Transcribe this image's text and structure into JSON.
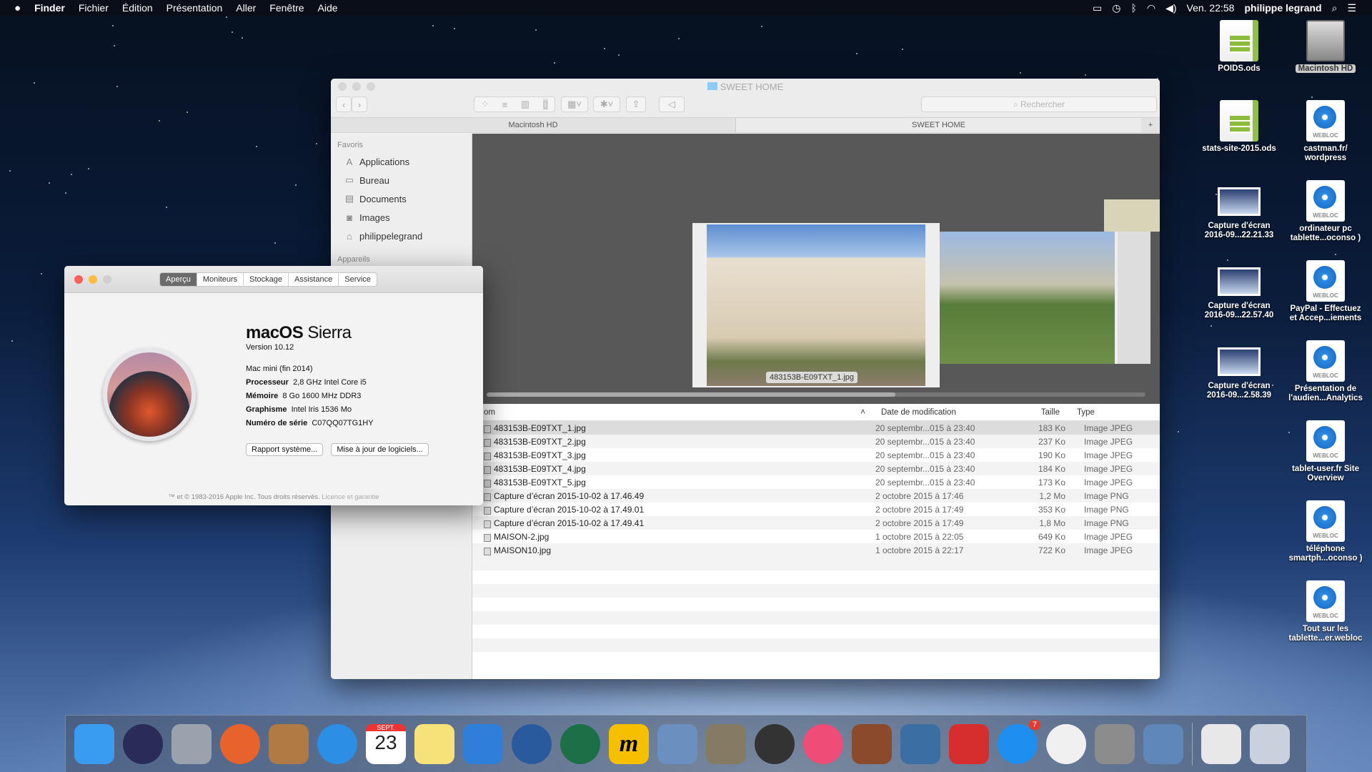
{
  "menubar": {
    "apple": "",
    "app": "Finder",
    "items": [
      "Fichier",
      "Édition",
      "Présentation",
      "Aller",
      "Fenêtre",
      "Aide"
    ],
    "clock": "Ven. 22:58",
    "user": "philippe legrand"
  },
  "finder": {
    "title": "SWEET HOME",
    "search_placeholder": "Rechercher",
    "tabs": [
      "Macintosh HD",
      "SWEET HOME"
    ],
    "sidebar": {
      "favorites_header": "Favoris",
      "favorites": [
        "Applications",
        "Bureau",
        "Documents",
        "Images",
        "philippelegrand"
      ],
      "devices_header": "Appareils"
    },
    "coverflow_caption": "483153B-E09TXT_1.jpg",
    "columns": {
      "name": "om",
      "date": "Date de modification",
      "size": "Taille",
      "type": "Type"
    },
    "files": [
      {
        "name": "483153B-E09TXT_1.jpg",
        "date": "20 septembr...015 à 23:40",
        "size": "183 Ko",
        "type": "Image JPEG"
      },
      {
        "name": "483153B-E09TXT_2.jpg",
        "date": "20 septembr...015 à 23:40",
        "size": "237 Ko",
        "type": "Image JPEG"
      },
      {
        "name": "483153B-E09TXT_3.jpg",
        "date": "20 septembr...015 à 23:40",
        "size": "190 Ko",
        "type": "Image JPEG"
      },
      {
        "name": "483153B-E09TXT_4.jpg",
        "date": "20 septembr...015 à 23:40",
        "size": "184 Ko",
        "type": "Image JPEG"
      },
      {
        "name": "483153B-E09TXT_5.jpg",
        "date": "20 septembr...015 à 23:40",
        "size": "173 Ko",
        "type": "Image JPEG"
      },
      {
        "name": "Capture d’écran 2015-10-02 à 17.46.49",
        "date": "2 octobre 2015 à 17:46",
        "size": "1,2 Mo",
        "type": "Image PNG"
      },
      {
        "name": "Capture d’écran 2015-10-02 à 17.49.01",
        "date": "2 octobre 2015 à 17:49",
        "size": "353 Ko",
        "type": "Image PNG"
      },
      {
        "name": "Capture d’écran 2015-10-02 à 17.49.41",
        "date": "2 octobre 2015 à 17:49",
        "size": "1,8 Mo",
        "type": "Image PNG"
      },
      {
        "name": "MAISON-2.jpg",
        "date": "1 octobre 2015 à 22:05",
        "size": "649 Ko",
        "type": "Image JPEG"
      },
      {
        "name": "MAISON10.jpg",
        "date": "1 octobre 2015 à 22:17",
        "size": "722 Ko",
        "type": "Image JPEG"
      }
    ]
  },
  "about": {
    "tabs": [
      "Aperçu",
      "Moniteurs",
      "Stockage",
      "Assistance",
      "Service"
    ],
    "os_name_bold": "macOS",
    "os_name": "Sierra",
    "version": "Version 10.12",
    "model": "Mac mini (fin 2014)",
    "specs": [
      {
        "label": "Processeur",
        "value": "2,8 GHz Intel Core i5"
      },
      {
        "label": "Mémoire",
        "value": "8 Go 1600 MHz DDR3"
      },
      {
        "label": "Graphisme",
        "value": "Intel Iris 1536 Mo"
      },
      {
        "label": "Numéro de série",
        "value": "C07QQ07TG1HY"
      }
    ],
    "buttons": [
      "Rapport système...",
      "Mise à jour de logiciels..."
    ],
    "copyright": "™ et © 1983-2016 Apple Inc. Tous droits réservés.",
    "license_link": "Licence et garantie"
  },
  "desktop": {
    "left": [
      {
        "label": "POIDS.ods",
        "kind": "ods"
      },
      {
        "label": "stats-site-2015.ods",
        "kind": "ods"
      },
      {
        "label": "Capture d'écran 2016-09...22.21.33",
        "kind": "shot"
      },
      {
        "label": "Capture d'écran 2016-09...22.57.40",
        "kind": "shot"
      },
      {
        "label": "Capture d'écran 2016-09...2.58.39",
        "kind": "shot"
      }
    ],
    "right": [
      {
        "label": "Macintosh HD",
        "kind": "hd"
      },
      {
        "label": "castman.fr/ wordpress",
        "kind": "web"
      },
      {
        "label": "ordinateur pc tablette...oconso )",
        "kind": "web"
      },
      {
        "label": "PayPal - Effectuez et Accep...iements",
        "kind": "web"
      },
      {
        "label": "Présentation de l'audien...Analytics",
        "kind": "web"
      },
      {
        "label": "tablet-user.fr Site Overview",
        "kind": "web"
      },
      {
        "label": "téléphone smartph...oconso )",
        "kind": "web"
      },
      {
        "label": "Tout sur les tablette...er.webloc",
        "kind": "web"
      }
    ]
  },
  "dock": {
    "calendar_month": "SEPT.",
    "calendar_day": "23",
    "appstore_badge": "7",
    "apps": [
      {
        "name": "finder",
        "color": "#3a9cf0"
      },
      {
        "name": "siri",
        "color": "#2b2b5a"
      },
      {
        "name": "launchpad",
        "color": "#9aa3ad"
      },
      {
        "name": "firefox",
        "color": "#e8632b"
      },
      {
        "name": "contacts",
        "color": "#b07a44"
      },
      {
        "name": "safari",
        "color": "#2d8ee6"
      },
      {
        "name": "calendar",
        "color": "#ffffff"
      },
      {
        "name": "notes",
        "color": "#f7e27a"
      },
      {
        "name": "openoffice",
        "color": "#2f7ed8"
      },
      {
        "name": "thunderbird",
        "color": "#2a5a9e"
      },
      {
        "name": "time-machine",
        "color": "#1d6f48"
      },
      {
        "name": "m-app",
        "color": "#f6c000"
      },
      {
        "name": "preview",
        "color": "#6b8fbf"
      },
      {
        "name": "gimp",
        "color": "#857a62"
      },
      {
        "name": "dashboard",
        "color": "#333333"
      },
      {
        "name": "itunes",
        "color": "#f04c78"
      },
      {
        "name": "archive",
        "color": "#8b4a2b"
      },
      {
        "name": "scanner",
        "color": "#3b6ea3"
      },
      {
        "name": "sketchup",
        "color": "#d62e2e"
      },
      {
        "name": "app-store",
        "color": "#1f8ef1"
      },
      {
        "name": "photos",
        "color": "#f0f0f0"
      },
      {
        "name": "system-preferences",
        "color": "#8c8c8c"
      },
      {
        "name": "migration",
        "color": "#5f87b8"
      }
    ]
  },
  "colors": {
    "close": "#fc605c",
    "minimize": "#fdbc40",
    "zoom": "#cfcfcf",
    "menubar": "#0a0e18"
  }
}
